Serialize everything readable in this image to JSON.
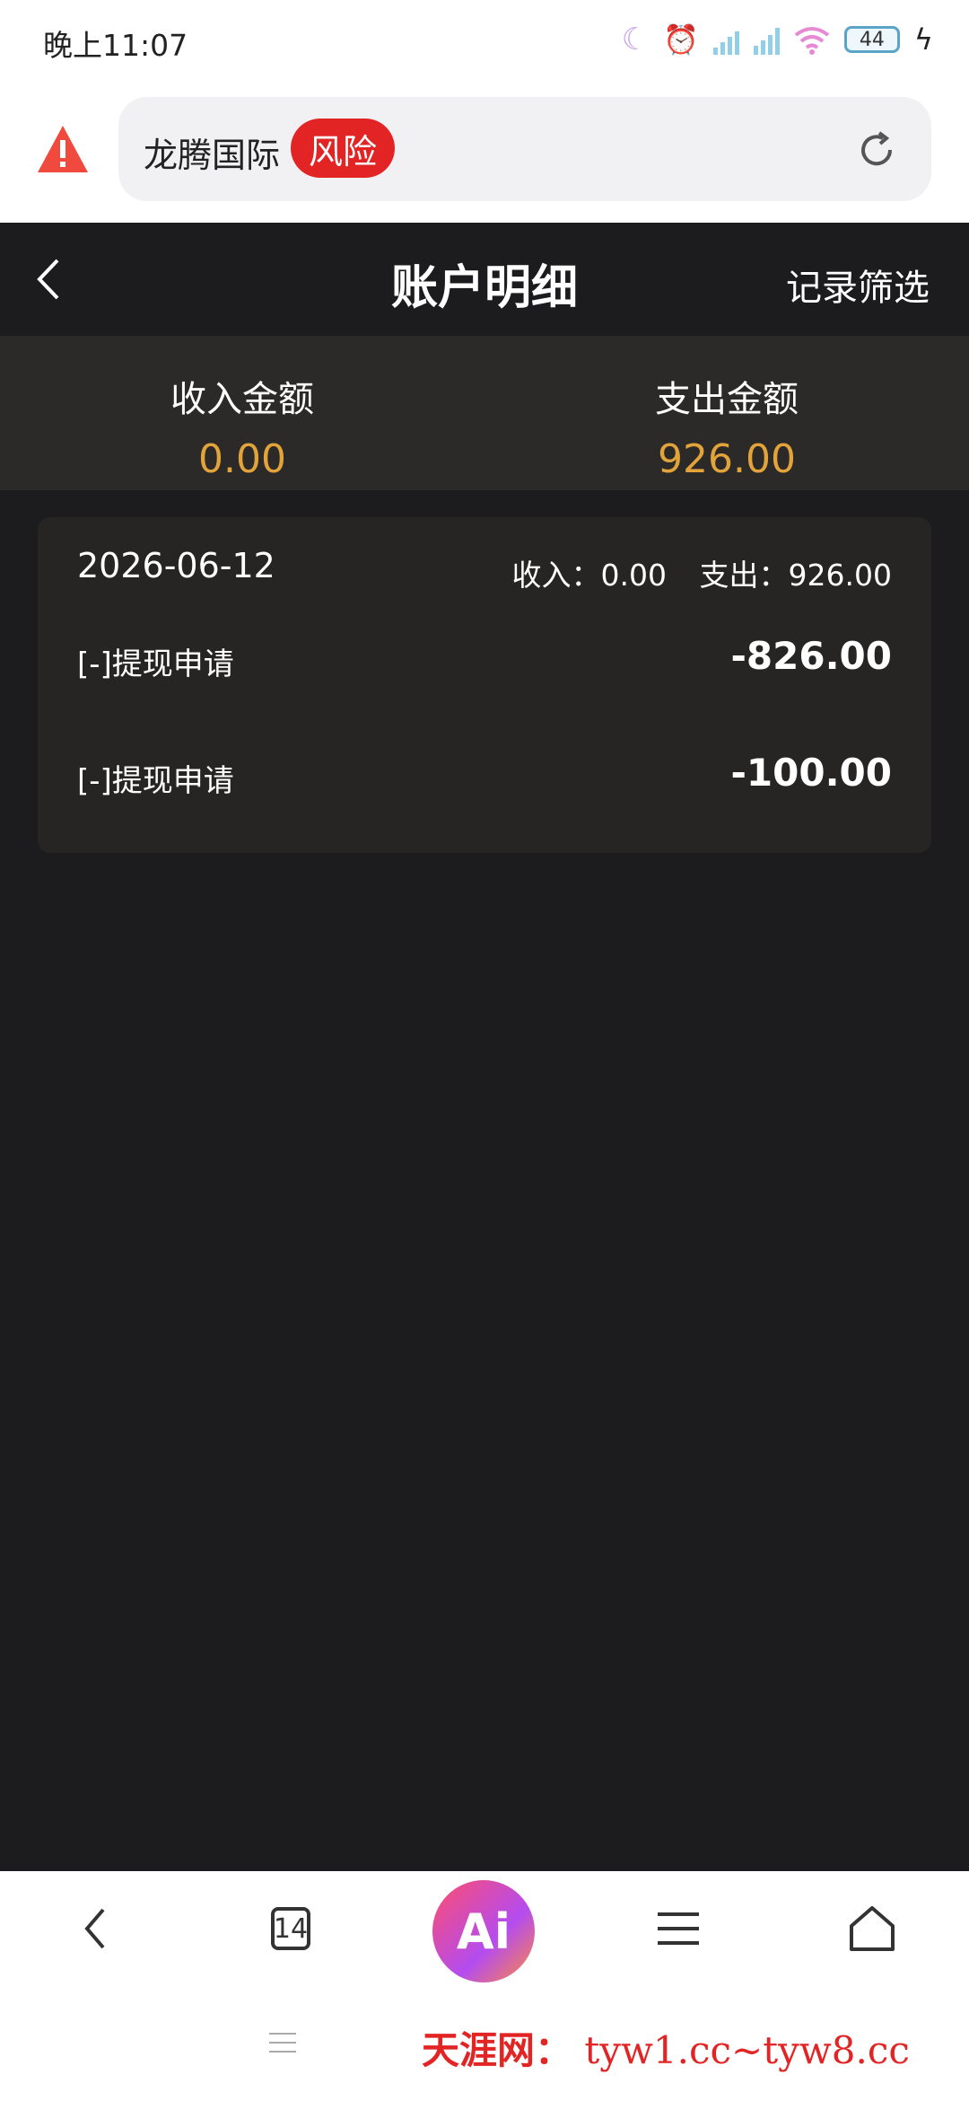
{
  "status_bar": {
    "time": "晚上11:07",
    "battery": "44"
  },
  "browser": {
    "site_name": "龙腾国际",
    "risk_badge": "风险"
  },
  "header": {
    "title": "账户明细",
    "filter_label": "记录筛选"
  },
  "summary": {
    "income_label": "收入金额",
    "income_value": "0.00",
    "expense_label": "支出金额",
    "expense_value": "926.00"
  },
  "records": [
    {
      "date": "2026-06-12",
      "income_text": "收入：0.00",
      "expense_text": "支出：926.00",
      "items": [
        {
          "name": "[-]提现申请",
          "amount": "-826.00"
        },
        {
          "name": "[-]提现申请",
          "amount": "-100.00"
        }
      ]
    }
  ],
  "bottom_nav": {
    "tabs_count": "14",
    "ai_label": "Ai"
  },
  "watermark": {
    "cn": "天涯网：",
    "url": "tyw1.cc~tyw8.cc"
  },
  "colors": {
    "accent": "#e3a33b",
    "risk": "#e32424",
    "background": "#1c1c1e"
  }
}
